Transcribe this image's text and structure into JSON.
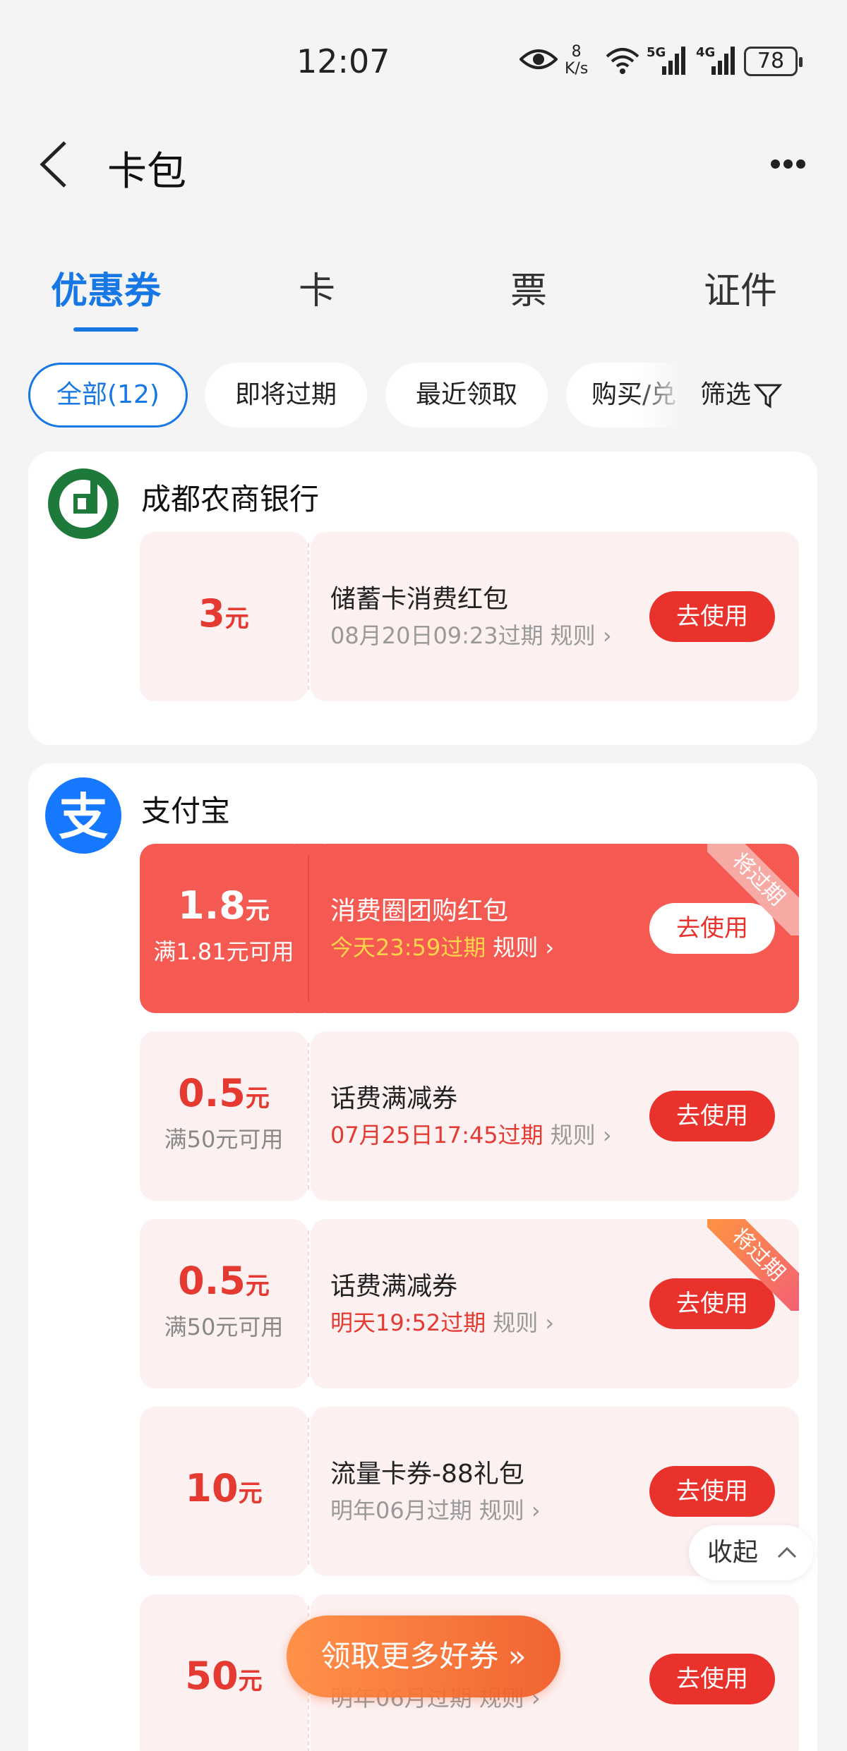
{
  "status": {
    "time": "12:07",
    "speed_value": "8",
    "speed_unit": "K/s",
    "sig1": "5G",
    "sig2": "4G",
    "battery": "78"
  },
  "header": {
    "title": "卡包"
  },
  "tabs": [
    "优惠券",
    "卡",
    "票",
    "证件"
  ],
  "filters": {
    "chips": [
      "全部(12)",
      "即将过期",
      "最近领取",
      "购买/兑"
    ],
    "filter_label": "筛选"
  },
  "merchants": [
    {
      "name": "成都农商银行",
      "coupons": [
        {
          "amount": "3",
          "unit": "元",
          "condition": "",
          "name": "储蓄卡消费红包",
          "expiry": "08月20日09:23过期",
          "rule": "规则",
          "button": "去使用"
        }
      ]
    },
    {
      "name": "支付宝",
      "coupons": [
        {
          "amount": "1.8",
          "unit": "元",
          "condition": "满1.81元可用",
          "name": "消费圈团购红包",
          "expiry": "今天23:59过期",
          "rule": "规则",
          "button": "去使用",
          "badge": "将过期"
        },
        {
          "amount": "0.5",
          "unit": "元",
          "condition": "满50元可用",
          "name": "话费满减券",
          "expiry": "07月25日17:45过期",
          "rule": "规则",
          "button": "去使用"
        },
        {
          "amount": "0.5",
          "unit": "元",
          "condition": "满50元可用",
          "name": "话费满减券",
          "expiry": "明天19:52过期",
          "rule": "规则",
          "button": "去使用",
          "badge": "将过期"
        },
        {
          "amount": "10",
          "unit": "元",
          "condition": "",
          "name": "流量卡券-88礼包",
          "expiry": "明年06月过期",
          "rule": "规则",
          "button": "去使用"
        },
        {
          "amount": "50",
          "unit": "元",
          "condition": "",
          "name": "",
          "expiry": "明年06月过期",
          "rule": "规则",
          "button": "去使用"
        }
      ]
    }
  ],
  "collapse_label": "收起",
  "float_button": "领取更多好券 »",
  "colors": {
    "accent": "#1677e5",
    "red": "#e8322b",
    "hot": "#f45a52",
    "orange": "#f15a24"
  }
}
